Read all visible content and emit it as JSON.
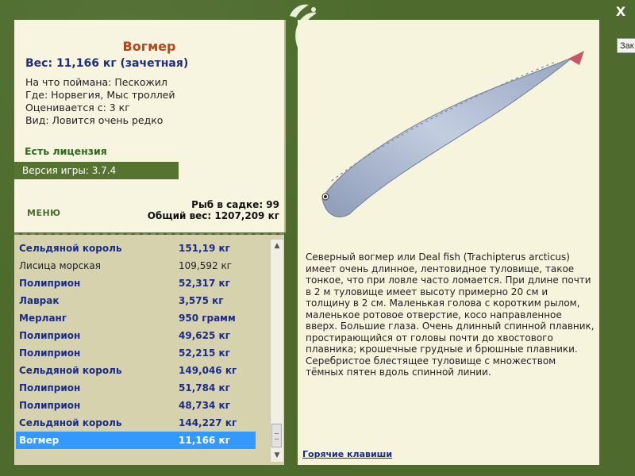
{
  "window": {
    "close_label": "X",
    "tooltip_text": "Зак"
  },
  "fish": {
    "name": "Вогмер",
    "weight_line": "Вес: 11,166 кг (зачетная)",
    "bait_line": "На что поймана: Пескожил",
    "location_line": "Где: Норвегия, Мыс троллей",
    "rated_line": "Оценивается с: 3 кг",
    "rarity_line": "Вид: Ловится очень редко"
  },
  "license_text": "Есть лицензия",
  "version_text": "Версия игры: 3.7.4",
  "menu_label": "МЕНЮ",
  "stats": {
    "count_line": "Рыб в садке: 99",
    "total_line": "Общий вес: 1207,209 кг"
  },
  "catch_list": [
    {
      "name": "Сельдяной король",
      "weight": "151,19 кг"
    },
    {
      "name": "Лисица морская",
      "weight": "109,592 кг"
    },
    {
      "name": "Полиприон",
      "weight": "52,317 кг"
    },
    {
      "name": "Лаврак",
      "weight": "3,575 кг"
    },
    {
      "name": "Мерланг",
      "weight": "950 грамм"
    },
    {
      "name": "Полиприон",
      "weight": "49,625 кг"
    },
    {
      "name": "Полиприон",
      "weight": "52,215 кг"
    },
    {
      "name": "Сельдяной король",
      "weight": "149,046 кг"
    },
    {
      "name": "Полиприон",
      "weight": "51,784 кг"
    },
    {
      "name": "Полиприон",
      "weight": "48,734 кг"
    },
    {
      "name": "Сельдяной король",
      "weight": "144,227 кг"
    },
    {
      "name": "Вогмер",
      "weight": "11,166 кг"
    }
  ],
  "description": "Северный вогмер или Deal fish (Trachipterus arcticus) имеет очень длинное, лентовидное туловище, такое тонкое, что при ловле часто ломается. При длине почти в 2 м туловище имеет высоту примерно 20 см и толщину в 2 см. Маленькая голова с коротким рылом, маленькое ротовое отверстие, косо направленное вверх. Большие глаза. Очень длинный спинной плавник, простирающийся от головы почти до хвостового плавника; крошечные грудные и брюшные плавники. Серебристое блестящее туловище с множеством тёмных пятен вдоль спинной линии.",
  "hotkeys_label": "Горячие клавиши",
  "colors": {
    "frame": "#4e6b2d",
    "panel": "#f7f4e0",
    "title": "#b5461a",
    "link": "#1b2c86",
    "selected": "#3399ff"
  }
}
